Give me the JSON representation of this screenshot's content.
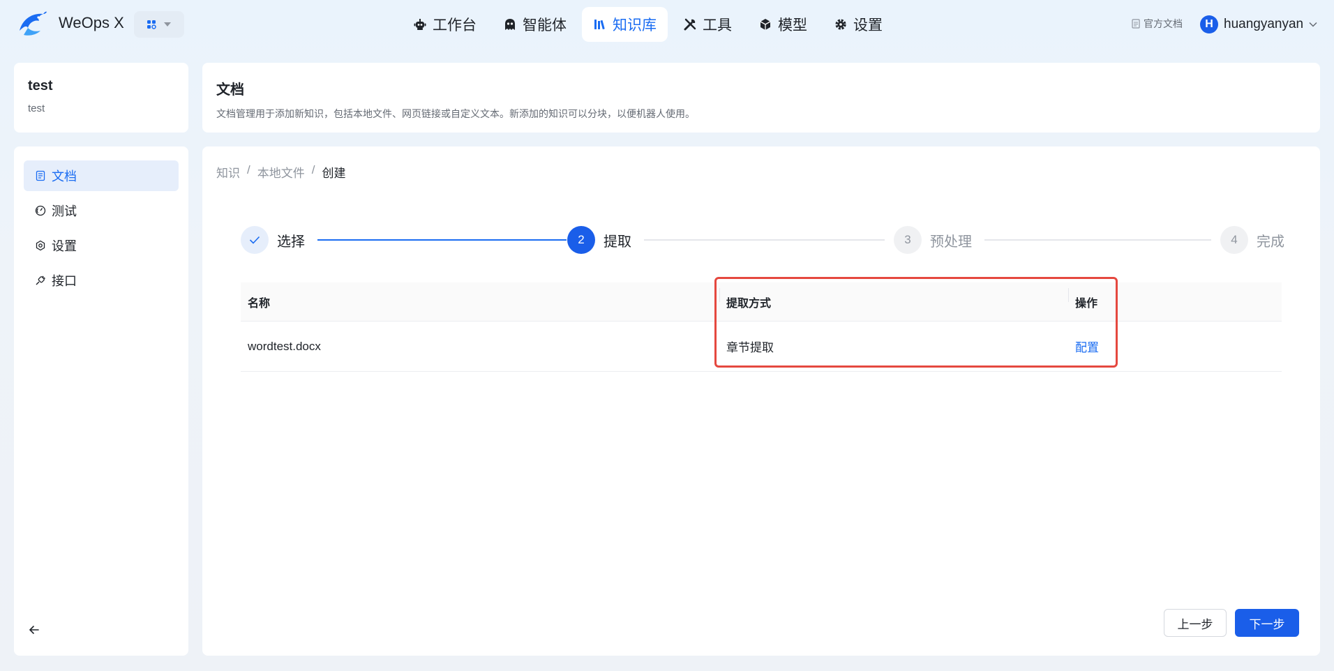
{
  "header": {
    "brand": "WeOps X",
    "nav": [
      {
        "label": "工作台",
        "icon": "robot-icon"
      },
      {
        "label": "智能体",
        "icon": "ghost-icon"
      },
      {
        "label": "知识库",
        "icon": "books-icon",
        "active": true
      },
      {
        "label": "工具",
        "icon": "tools-icon"
      },
      {
        "label": "模型",
        "icon": "cube-icon"
      },
      {
        "label": "设置",
        "icon": "gear-icon"
      }
    ],
    "doc_link": "官方文档",
    "user": {
      "avatar_letter": "H",
      "name": "huangyanyan"
    }
  },
  "knowledge": {
    "name": "test",
    "desc": "test"
  },
  "sidebar": {
    "items": [
      {
        "label": "文档",
        "icon": "document-icon",
        "active": true
      },
      {
        "label": "测试",
        "icon": "gauge-icon"
      },
      {
        "label": "设置",
        "icon": "settings-icon"
      },
      {
        "label": "接口",
        "icon": "plug-icon"
      }
    ]
  },
  "intro": {
    "title": "文档",
    "desc": "文档管理用于添加新知识，包括本地文件、网页链接或自定义文本。新添加的知识可以分块，以便机器人使用。"
  },
  "breadcrumb": {
    "items": [
      "知识",
      "本地文件",
      "创建"
    ],
    "separator": "/"
  },
  "steps": [
    {
      "number": "1",
      "label": "选择",
      "status": "done"
    },
    {
      "number": "2",
      "label": "提取",
      "status": "active"
    },
    {
      "number": "3",
      "label": "预处理",
      "status": "wait"
    },
    {
      "number": "4",
      "label": "完成",
      "status": "wait"
    }
  ],
  "table": {
    "headers": {
      "name": "名称",
      "method": "提取方式",
      "op": "操作"
    },
    "rows": [
      {
        "name": "wordtest.docx",
        "method": "章节提取",
        "op": "配置"
      }
    ]
  },
  "buttons": {
    "prev": "上一步",
    "next": "下一步"
  },
  "colors": {
    "primary": "#1a5ee9",
    "highlight_border": "#e5483f"
  }
}
